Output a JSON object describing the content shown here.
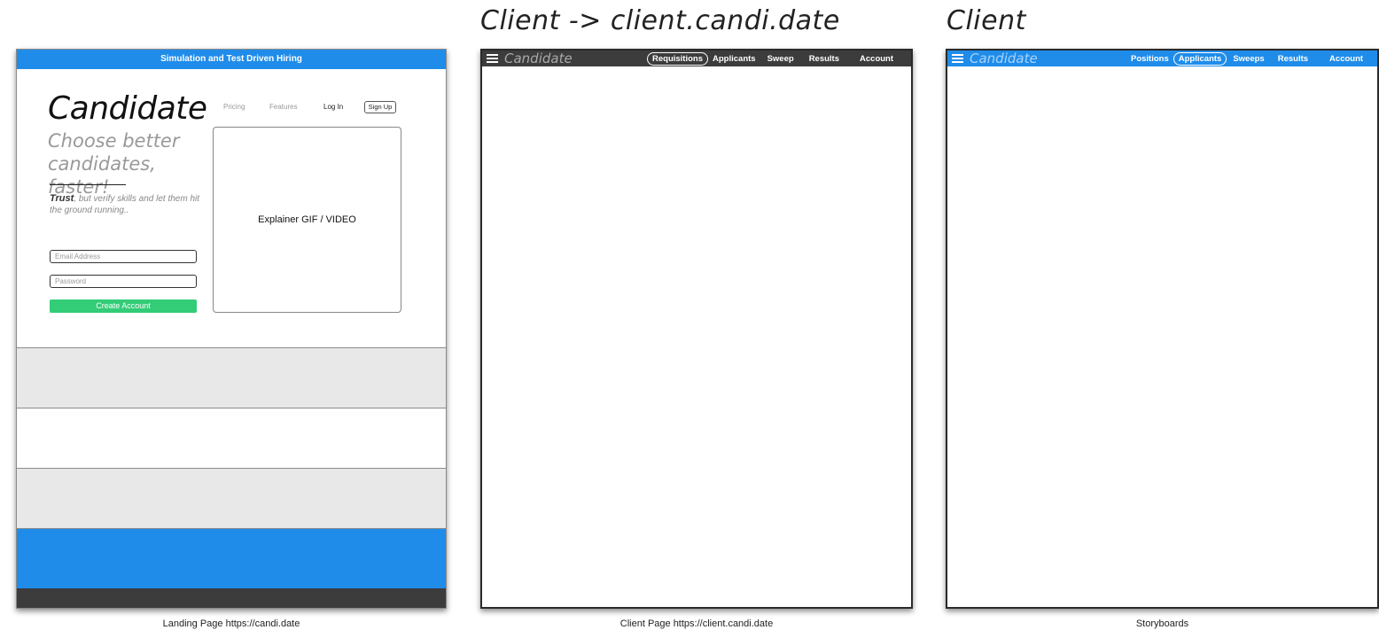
{
  "headings": {
    "client_frame": "Client -> client.candi.date",
    "storyboard_frame": "Client"
  },
  "captions": {
    "landing": "Landing Page https://candi.date",
    "client": "Client Page https://client.candi.date",
    "storyboard": "Storyboards"
  },
  "landing": {
    "banner": "Simulation and Test Driven Hiring",
    "logo": "Candidate",
    "nav": {
      "pricing": "Pricing",
      "features": "Features",
      "login": "Log In",
      "signup": "Sign Up"
    },
    "tagline": "Choose better candidates, faster!",
    "trust_bold": "Trust",
    "trust_rest": ", but verify skills and let them hit the ground running..",
    "email_placeholder": "Email Address",
    "password_placeholder": "Password",
    "create_account": "Create Account",
    "video_placeholder": "Explainer GIF / VIDEO"
  },
  "client_app": {
    "logo": "Candidate",
    "nav": [
      "Requisitions",
      "Applicants",
      "Sweep",
      "Results",
      "Account"
    ],
    "active_nav": "Requisitions"
  },
  "storyboard_app": {
    "logo": "Candidate",
    "nav": [
      "Positions",
      "Applicants",
      "Sweeps",
      "Results",
      "Account"
    ],
    "active_nav": "Applicants"
  },
  "colors": {
    "brand_blue": "#1f8cea",
    "dark_bar": "#3c3c3c",
    "cta_green": "#33cc77",
    "band_gray": "#e8e8e8"
  }
}
